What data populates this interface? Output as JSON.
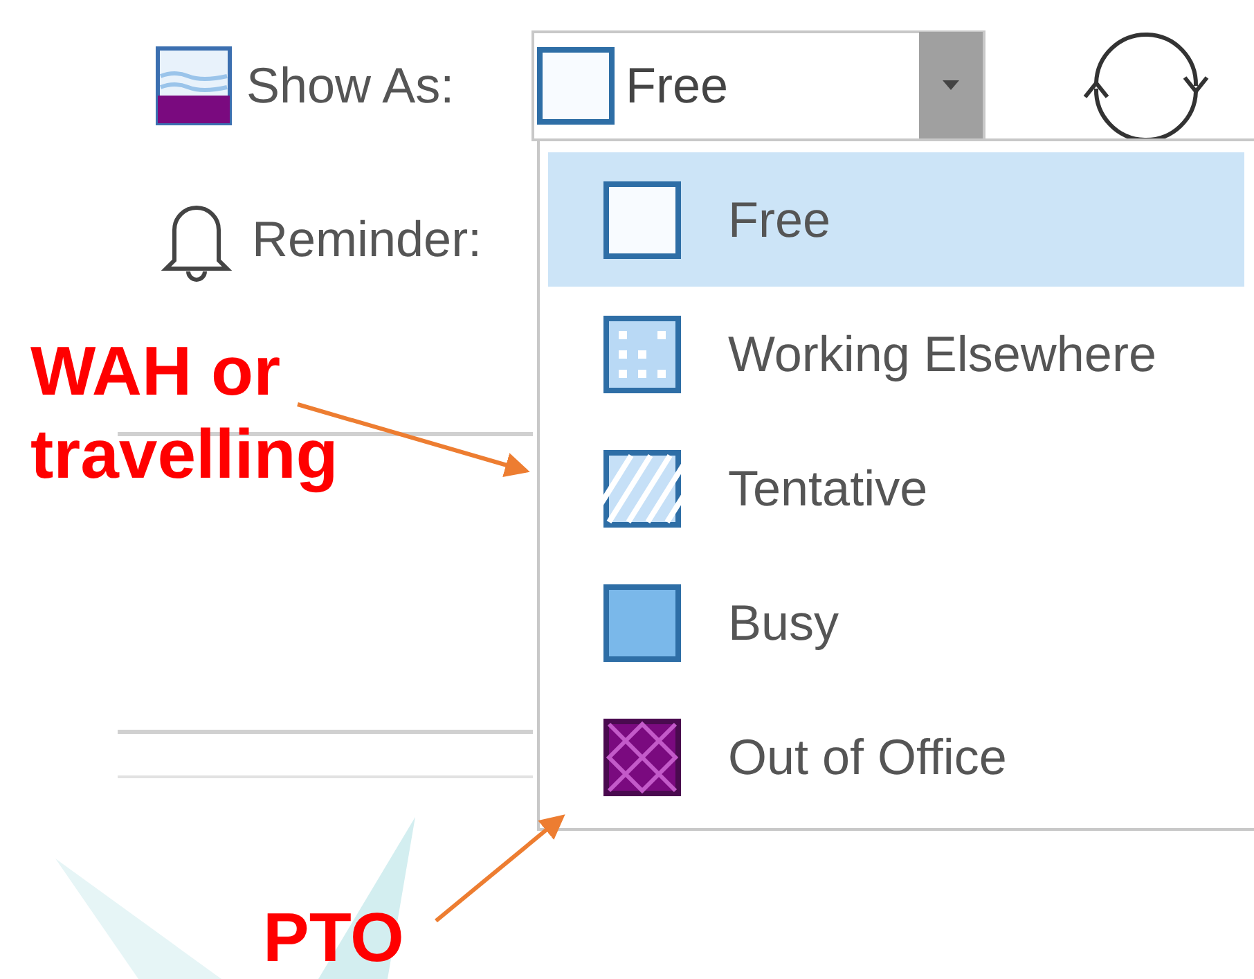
{
  "toolbar": {
    "show_as": {
      "label": "Show As:",
      "value": "Free",
      "kind": "free"
    },
    "reminder": {
      "label": "Reminder:"
    }
  },
  "dropdown": {
    "items": [
      {
        "label": "Free",
        "kind": "free",
        "selected": true
      },
      {
        "label": "Working Elsewhere",
        "kind": "elsewhere",
        "selected": false
      },
      {
        "label": "Tentative",
        "kind": "tentative",
        "selected": false
      },
      {
        "label": "Busy",
        "kind": "busy",
        "selected": false
      },
      {
        "label": "Out of Office",
        "kind": "oof",
        "selected": false
      }
    ]
  },
  "annotations": [
    {
      "text": "WAH or travelling"
    },
    {
      "text": "PTO"
    }
  ]
}
